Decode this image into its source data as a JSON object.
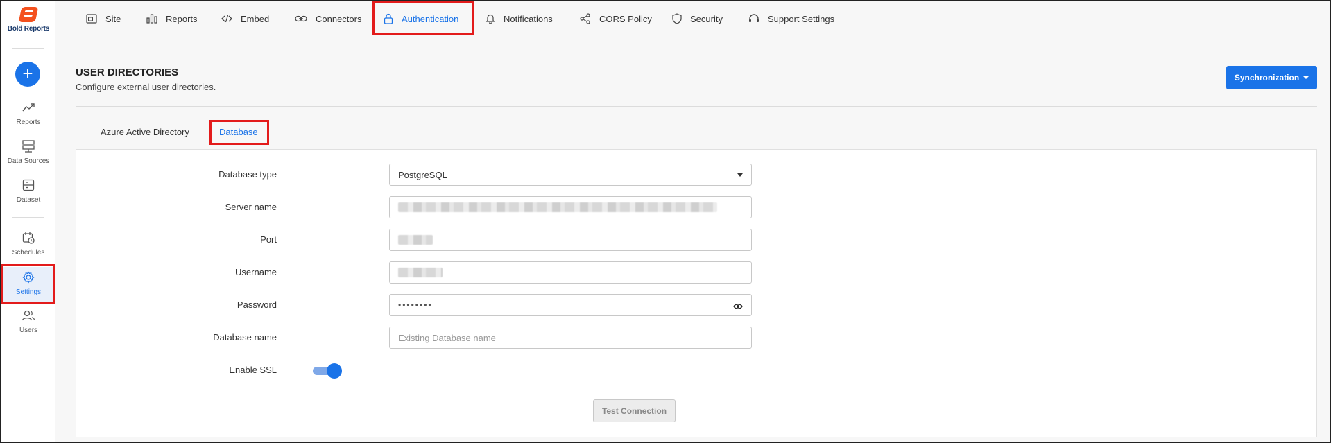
{
  "brand": {
    "name": "Bold Reports",
    "color": "#f4511e",
    "accent": "#1a73e8"
  },
  "sidebar": {
    "add_label": "+",
    "items": [
      {
        "label": "Reports",
        "icon": "trend-icon"
      },
      {
        "label": "Data Sources",
        "icon": "server-icon"
      },
      {
        "label": "Dataset",
        "icon": "dataset-icon"
      },
      {
        "label": "Schedules",
        "icon": "calendar-clock-icon"
      },
      {
        "label": "Settings",
        "icon": "gear-icon",
        "active": true
      },
      {
        "label": "Users",
        "icon": "users-icon"
      }
    ]
  },
  "topnav": {
    "tabs": [
      {
        "label": "Site",
        "icon": "site-icon"
      },
      {
        "label": "Reports",
        "icon": "bar-chart-icon"
      },
      {
        "label": "Embed",
        "icon": "code-icon"
      },
      {
        "label": "Connectors",
        "icon": "link-icon"
      },
      {
        "label": "Authentication",
        "icon": "lock-icon",
        "active": true
      },
      {
        "label": "Notifications",
        "icon": "bell-icon"
      },
      {
        "label": "CORS Policy",
        "icon": "share-icon"
      },
      {
        "label": "Security",
        "icon": "shield-icon"
      },
      {
        "label": "Support Settings",
        "icon": "headset-icon"
      }
    ]
  },
  "header": {
    "title": "USER DIRECTORIES",
    "subtitle": "Configure external user directories.",
    "sync_button": "Synchronization"
  },
  "subtabs": [
    {
      "label": "Azure Active Directory"
    },
    {
      "label": "Database",
      "active": true
    }
  ],
  "form": {
    "database_type": {
      "label": "Database type",
      "value": "PostgreSQL"
    },
    "server_name": {
      "label": "Server name"
    },
    "port": {
      "label": "Port"
    },
    "username": {
      "label": "Username"
    },
    "password": {
      "label": "Password",
      "value": "••••••••"
    },
    "database_name": {
      "label": "Database name",
      "placeholder": "Existing Database name"
    },
    "enable_ssl": {
      "label": "Enable SSL",
      "on": true
    },
    "test_button": "Test Connection"
  }
}
